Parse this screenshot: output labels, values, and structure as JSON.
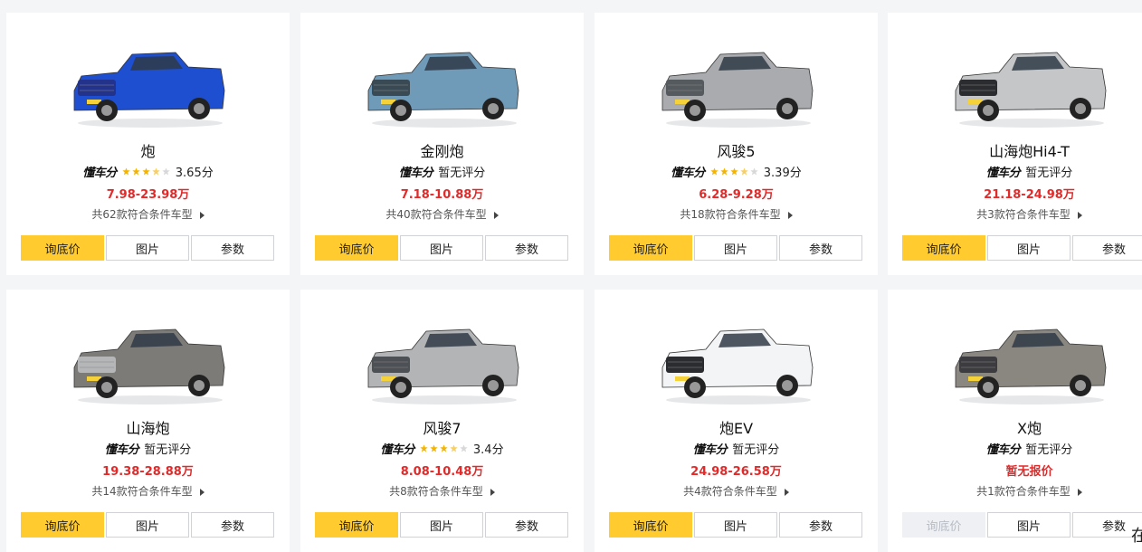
{
  "cards": [
    {
      "name": "炮",
      "rating_logo": "懂车分",
      "score": "3.65分",
      "stars": 3.5,
      "price": "7.98-23.98万",
      "count": "共62款符合条件车型",
      "color": "#1e4fd0",
      "grille": "#23328a",
      "btn_price": "询底价",
      "btn_photo": "图片",
      "btn_param": "参数",
      "price_disabled": false
    },
    {
      "name": "金刚炮",
      "rating_logo": "懂车分",
      "score": "暂无评分",
      "stars": null,
      "price": "7.18-10.88万",
      "count": "共40款符合条件车型",
      "color": "#6f9ab8",
      "grille": "#3a4a55",
      "btn_price": "询底价",
      "btn_photo": "图片",
      "btn_param": "参数",
      "price_disabled": false
    },
    {
      "name": "风骏5",
      "rating_logo": "懂车分",
      "score": "3.39分",
      "stars": 3.5,
      "price": "6.28-9.28万",
      "count": "共18款符合条件车型",
      "color": "#a9abae",
      "grille": "#555a5f",
      "btn_price": "询底价",
      "btn_photo": "图片",
      "btn_param": "参数",
      "price_disabled": false
    },
    {
      "name": "山海炮Hi4-T",
      "rating_logo": "懂车分",
      "score": "暂无评分",
      "stars": null,
      "price": "21.18-24.98万",
      "count": "共3款符合条件车型",
      "color": "#c4c6c8",
      "grille": "#2a2c2f",
      "btn_price": "询底价",
      "btn_photo": "图片",
      "btn_param": "参数",
      "price_disabled": false
    },
    {
      "name": "山海炮",
      "rating_logo": "懂车分",
      "score": "暂无评分",
      "stars": null,
      "price": "19.38-28.88万",
      "count": "共14款符合条件车型",
      "color": "#7d7b78",
      "grille": "#b4b6b8",
      "btn_price": "询底价",
      "btn_photo": "图片",
      "btn_param": "参数",
      "price_disabled": false
    },
    {
      "name": "风骏7",
      "rating_logo": "懂车分",
      "score": "3.4分",
      "stars": 3.5,
      "price": "8.08-10.48万",
      "count": "共8款符合条件车型",
      "color": "#b3b4b5",
      "grille": "#4d5156",
      "btn_price": "询底价",
      "btn_photo": "图片",
      "btn_param": "参数",
      "price_disabled": false
    },
    {
      "name": "炮EV",
      "rating_logo": "懂车分",
      "score": "暂无评分",
      "stars": null,
      "price": "24.98-26.58万",
      "count": "共4款符合条件车型",
      "color": "#f3f4f5",
      "grille": "#2a2c30",
      "btn_price": "询底价",
      "btn_photo": "图片",
      "btn_param": "参数",
      "price_disabled": false
    },
    {
      "name": "X炮",
      "rating_logo": "懂车分",
      "score": "暂无评分",
      "stars": null,
      "price": "暂无报价",
      "count": "共1款符合条件车型",
      "color": "#8a8680",
      "grille": "#3c3c40",
      "btn_price": "询底价",
      "btn_photo": "图片",
      "btn_param": "参数",
      "price_disabled": true
    }
  ],
  "colors": {
    "accent": "#ffcb2e",
    "price_red": "#e12a2a",
    "star_gold": "#f5b400",
    "star_empty": "#d8d8d8"
  },
  "tail_text": "在"
}
